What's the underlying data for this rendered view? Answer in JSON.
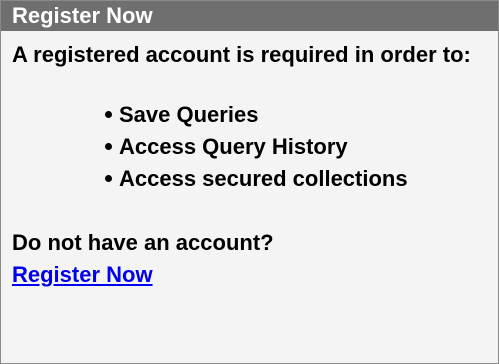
{
  "panel": {
    "title": "Register Now",
    "intro": "A registered account is required in order to:",
    "features": [
      "Save Queries",
      "Access Query History",
      "Access secured collections"
    ],
    "question": "Do not have an account?",
    "link_label": "Register Now"
  },
  "colors": {
    "header_background": "#6f6f6f",
    "header_text": "#ffffff",
    "body_background": "#f4f4f4",
    "link": "#0000ee",
    "border": "#8a8a8a"
  }
}
